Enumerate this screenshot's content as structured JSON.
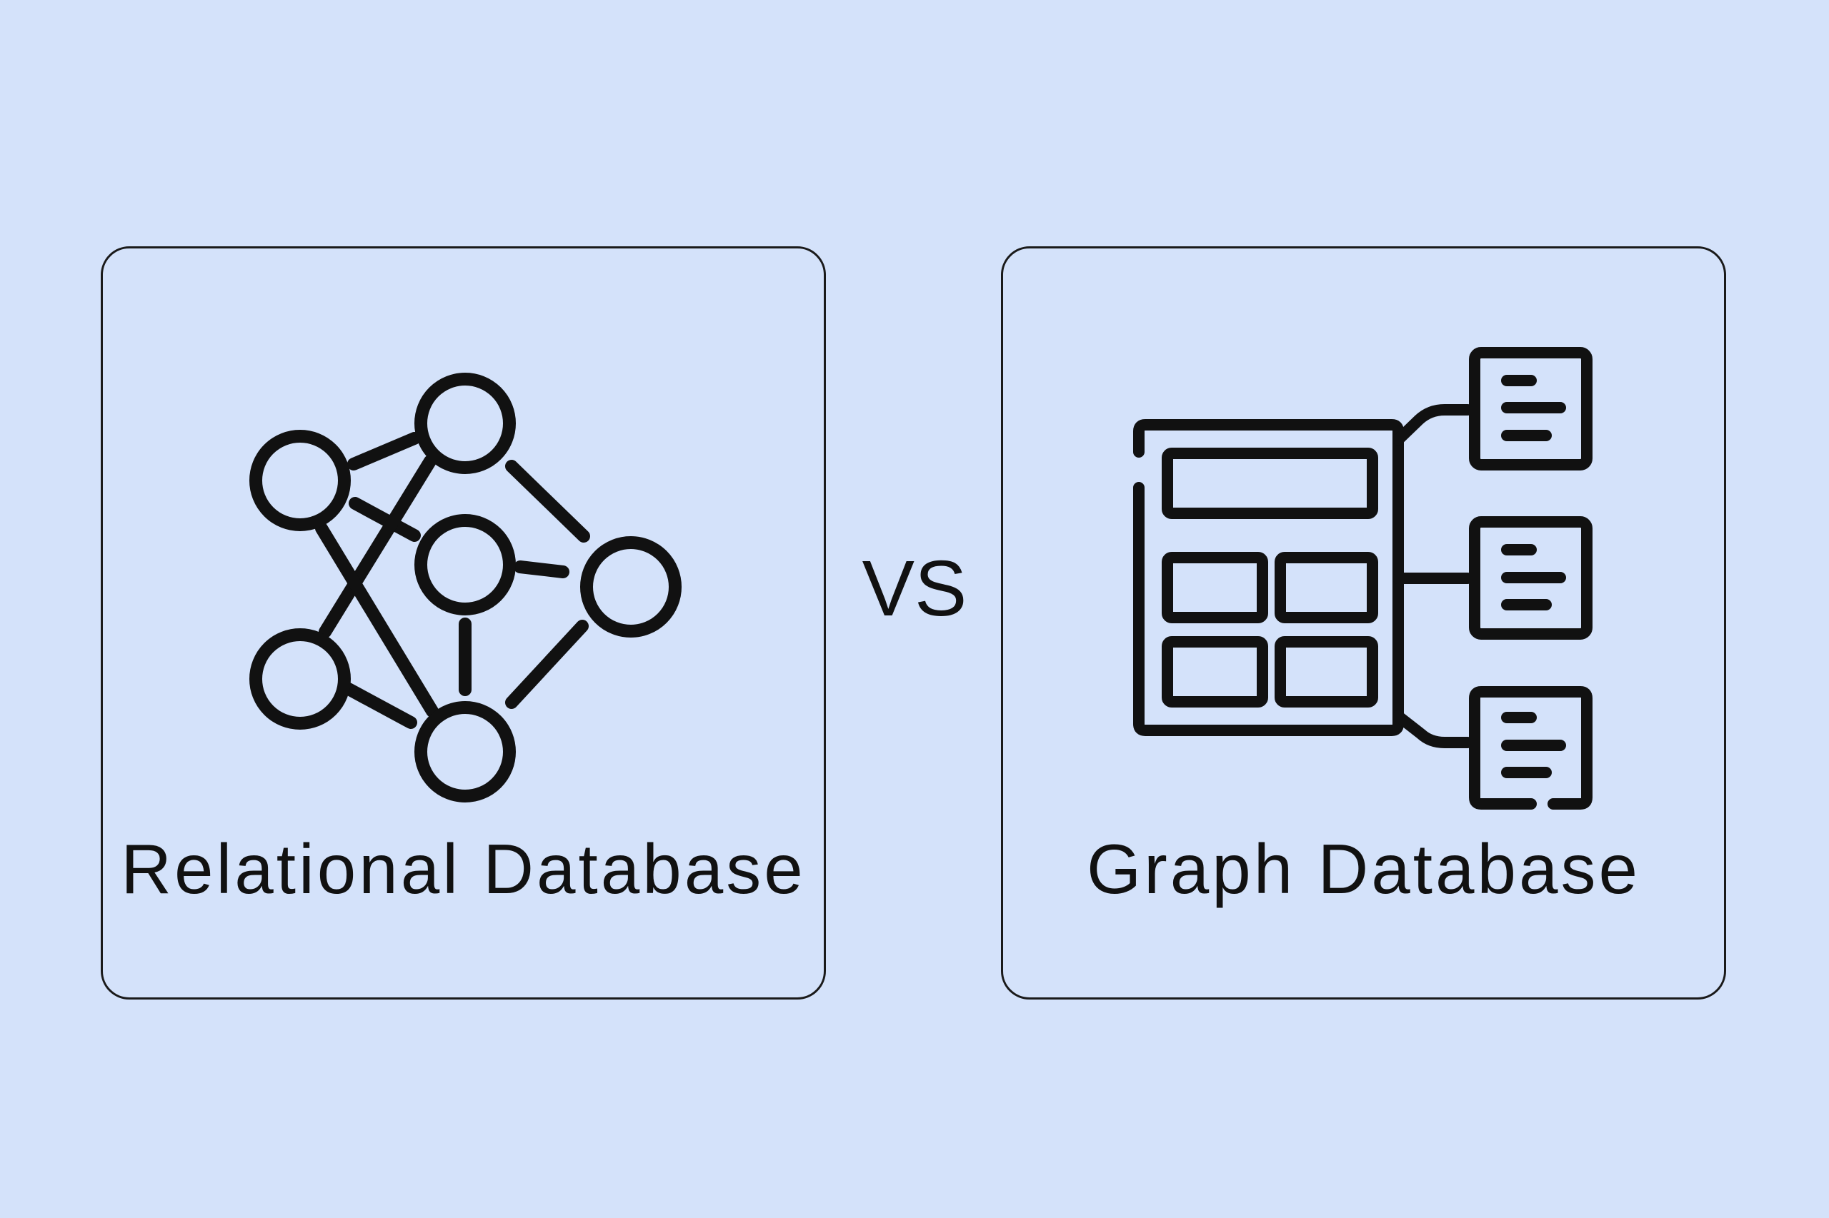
{
  "background_color": "#d4e2fa",
  "stroke_color": "#111111",
  "left_card": {
    "icon": "network-nodes-icon",
    "label": "Relational Database"
  },
  "separator": {
    "label": "VS"
  },
  "right_card": {
    "icon": "schema-documents-icon",
    "label": "Graph Database"
  }
}
